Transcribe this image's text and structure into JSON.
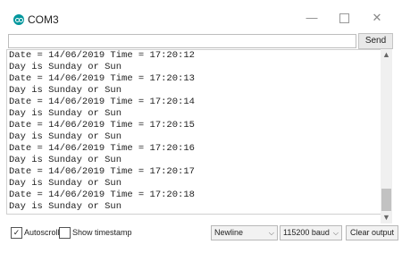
{
  "window": {
    "title": "COM3"
  },
  "send": {
    "input_value": "",
    "button_label": "Send"
  },
  "output": {
    "lines": [
      "Date = 14/06/2019 Time = 17:20:12",
      "Day is Sunday or Sun",
      "Date = 14/06/2019 Time = 17:20:13",
      "Day is Sunday or Sun",
      "Date = 14/06/2019 Time = 17:20:14",
      "Day is Sunday or Sun",
      "Date = 14/06/2019 Time = 17:20:15",
      "Day is Sunday or Sun",
      "Date = 14/06/2019 Time = 17:20:16",
      "Day is Sunday or Sun",
      "Date = 14/06/2019 Time = 17:20:17",
      "Day is Sunday or Sun",
      "Date = 14/06/2019 Time = 17:20:18",
      "Day is Sunday or Sun"
    ]
  },
  "bottom": {
    "autoscroll_label": "Autoscroll",
    "autoscroll_checked": true,
    "timestamp_label": "Show timestamp",
    "timestamp_checked": false,
    "line_ending": "Newline",
    "baud_rate": "115200 baud",
    "clear_label": "Clear output"
  },
  "colors": {
    "accent": "#00979d"
  }
}
